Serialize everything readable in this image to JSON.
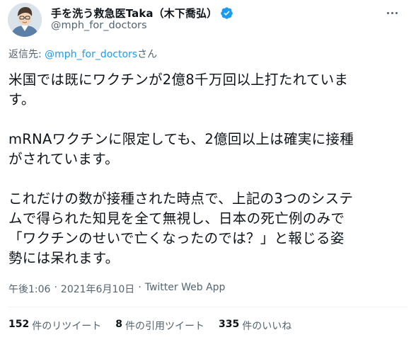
{
  "author": {
    "display_name": "手を洗う救急医Taka（木下喬弘）",
    "handle": "@mph_for_doctors",
    "verified_color": "#1d9bf0"
  },
  "reply": {
    "prefix": "返信先: ",
    "target": "@mph_for_doctors",
    "suffix": "さん"
  },
  "tweet": {
    "paragraphs": [
      [
        "米国では既にワクチンが2億8千万回以上打たれていま",
        "す。"
      ],
      [
        "mRNAワクチンに限定しても、2億回以上は確実に接種",
        "がされています。"
      ],
      [
        "これだけの数が接種された時点で、上記の3つのシステ",
        "ムで得られた知見を全て無視し、日本の死亡例のみで",
        "「ワクチンのせいで亡くなったのでは？」と報じる姿",
        "勢には呆れます。"
      ]
    ]
  },
  "meta": {
    "time": "午後1:06",
    "separator1": "·",
    "date": "2021年6月10日",
    "separator2": "·",
    "source": "Twitter Web App"
  },
  "stats": {
    "retweets": {
      "count": "152",
      "label": "件のリツイート"
    },
    "quotes": {
      "count": "8",
      "label": "件の引用ツイート"
    },
    "likes": {
      "count": "335",
      "label": "件のいいね"
    }
  },
  "colors": {
    "text": "#0f1419",
    "secondary": "#536471",
    "link": "#1d9bf0",
    "divider": "#eff3f4"
  }
}
